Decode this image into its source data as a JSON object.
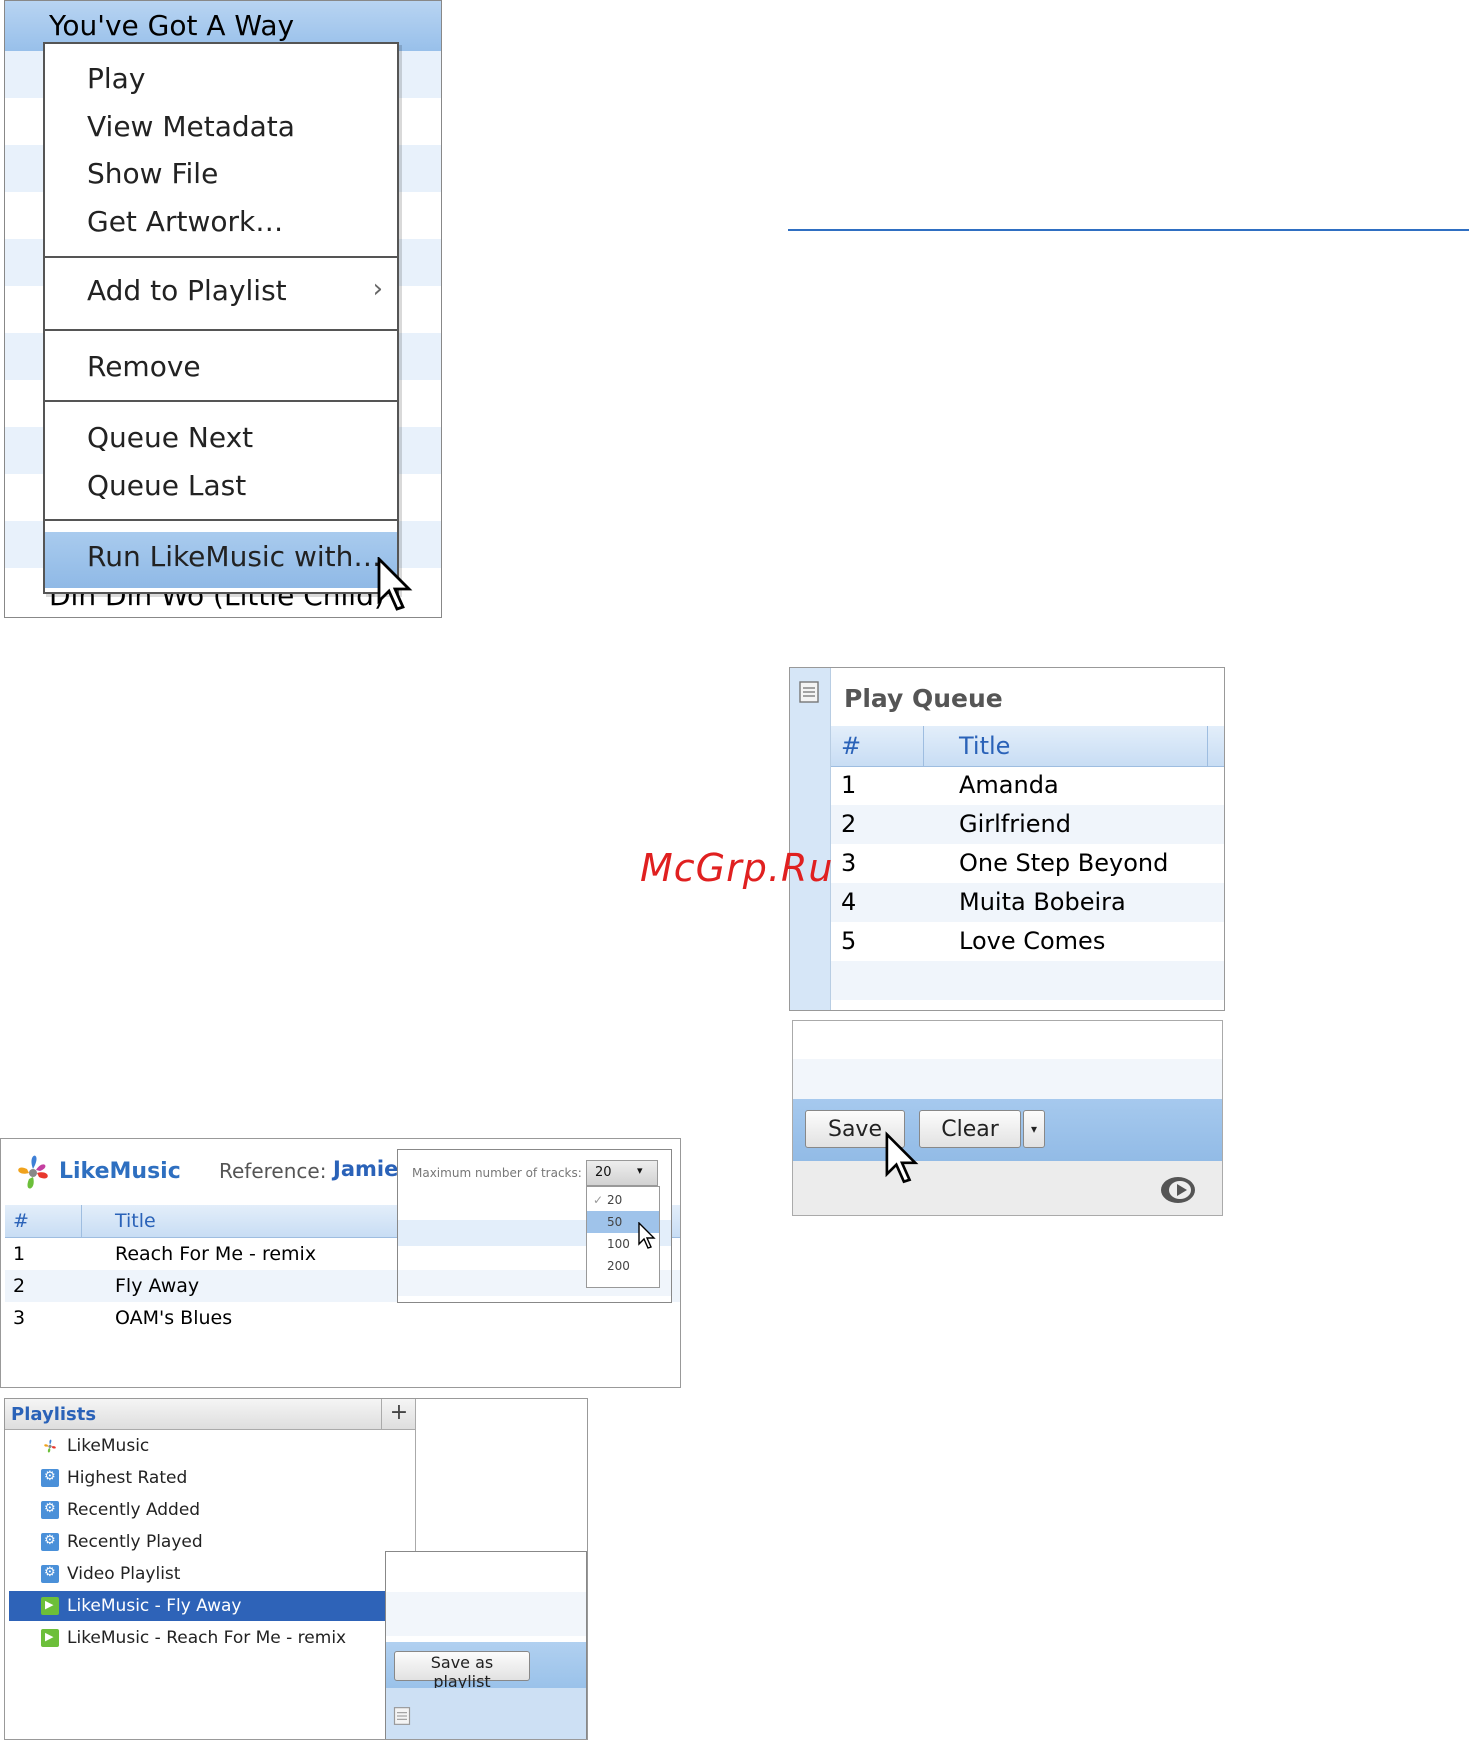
{
  "context_menu": {
    "header_track": "You've Got A Way",
    "footer_track": "Din Din Wo (Little Child)",
    "group1": [
      "Play",
      "View Metadata",
      "Show File",
      "Get Artwork…"
    ],
    "add_to_playlist": "Add to Playlist",
    "remove": "Remove",
    "queue_next": "Queue Next",
    "queue_last": "Queue Last",
    "run_likemusic": "Run LikeMusic with…"
  },
  "play_queue": {
    "title": "Play Queue",
    "col_num": "#",
    "col_title": "Title",
    "rows": [
      {
        "n": "1",
        "title": "Amanda"
      },
      {
        "n": "2",
        "title": "Girlfriend"
      },
      {
        "n": "3",
        "title": "One Step Beyond"
      },
      {
        "n": "4",
        "title": "Muita Bobeira"
      },
      {
        "n": "5",
        "title": "Love Comes"
      }
    ]
  },
  "queue_buttons": {
    "save": "Save",
    "clear": "Clear"
  },
  "likemusic": {
    "logo": "LikeMusic",
    "reference_label": "Reference:",
    "reference_value": "Jamie",
    "col_num": "#",
    "col_title": "Title",
    "rows": [
      {
        "n": "1",
        "title": "Reach For Me - remix"
      },
      {
        "n": "2",
        "title": "Fly Away"
      },
      {
        "n": "3",
        "title": "OAM's Blues"
      }
    ],
    "max_tracks_label": "Maximum number of tracks:",
    "max_tracks_value": "20",
    "max_tracks_options": [
      "20",
      "50",
      "100",
      "200"
    ],
    "selected_check": "✓"
  },
  "playlists": {
    "title": "Playlists",
    "add": "+",
    "items": [
      {
        "label": "LikeMusic",
        "icon": "likemusic-icon"
      },
      {
        "label": "Highest Rated",
        "icon": "gear-icon"
      },
      {
        "label": "Recently Added",
        "icon": "gear-icon"
      },
      {
        "label": "Recently Played",
        "icon": "gear-icon"
      },
      {
        "label": "Video Playlist",
        "icon": "gear-icon"
      },
      {
        "label": "LikeMusic - Fly Away",
        "icon": "play-icon"
      },
      {
        "label": "LikeMusic - Reach For Me - remix",
        "icon": "play-icon"
      }
    ],
    "save_as_playlist": "Save as playlist"
  },
  "watermark": "McGrp.Ru",
  "colors": {
    "accent": "#2a62b8",
    "selection": "#2e63b8",
    "highlight": "#9fc3ea"
  }
}
